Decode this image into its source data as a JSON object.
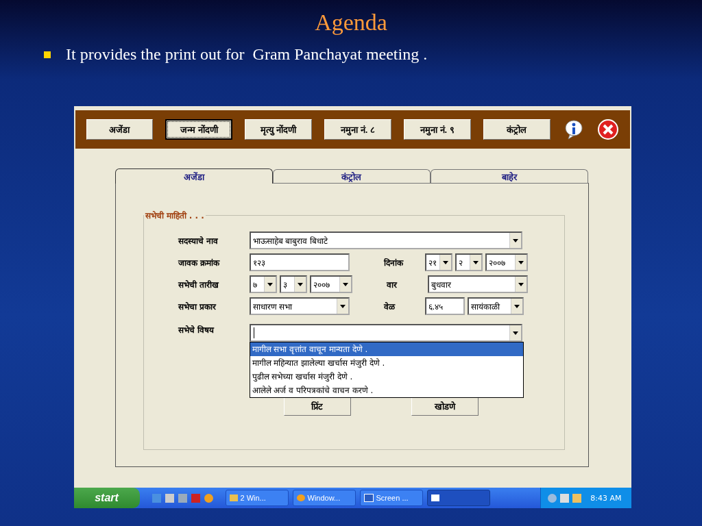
{
  "slide": {
    "title": "Agenda",
    "bullets": [
      "It provides the print out for  Gram Panchayat meeting ."
    ]
  },
  "app": {
    "toolbar": [
      {
        "label": "अजेंडा",
        "focused": false
      },
      {
        "label": "जन्म नोंदणी",
        "focused": true
      },
      {
        "label": "मृत्यु नोंदणी",
        "focused": false
      },
      {
        "label": "नमुना नं. ८",
        "focused": false
      },
      {
        "label": "नमुना नं. ९",
        "focused": false
      },
      {
        "label": "कंट्रोल",
        "focused": false
      }
    ],
    "tabs": [
      {
        "label": "अजेंडा",
        "selected": true
      },
      {
        "label": "कंट्रोल",
        "selected": false
      },
      {
        "label": "बाहेर",
        "selected": false
      }
    ],
    "group_title": "सभेची माहिती . . .",
    "member": {
      "label": "सदस्याचे नाव",
      "value": "भाऊसाहेब बाबुराव बिधाटे"
    },
    "outward_no": {
      "label": "जावक क्रमांक",
      "value": "१२३"
    },
    "date": {
      "label": "दिनांक",
      "parts": [
        "२१",
        "२",
        "२००७"
      ]
    },
    "meeting_date": {
      "label": "सभेची तारीख",
      "parts": [
        "७",
        "३",
        "२००७"
      ]
    },
    "weekday": {
      "label": "वार",
      "value": "बुधवार"
    },
    "meeting_type": {
      "label": "सभेचा प्रकार",
      "value": "साधारण सभा"
    },
    "time": {
      "label": "वेळ",
      "value": "६.४५",
      "period": "सायंकाळी"
    },
    "subject": {
      "label": "सभेचे विषय",
      "options": [
        {
          "text": "मागील सभा वृत्तांत वाचून मान्यता देणे .",
          "selected": true
        },
        {
          "text": "मागील महिन्यात झालेल्या खर्चास मंजुरी देणे .",
          "selected": false
        },
        {
          "text": "पुढील सभेच्या खर्चास मंजुरी देणे .",
          "selected": false
        },
        {
          "text": "आलेले अर्ज व परिपत्रकांचे वाचन करणे .",
          "selected": false
        }
      ]
    },
    "actions": [
      "प्रिंट",
      "खोडणे"
    ]
  },
  "taskbar": {
    "start": "start",
    "tasks": [
      {
        "label": "2 Win...",
        "kind": "group",
        "selected": false
      },
      {
        "label": "Window...",
        "kind": "player",
        "selected": false
      },
      {
        "label": "Screen ...",
        "kind": "doc",
        "selected": false
      },
      {
        "kind": "window",
        "selected": true
      }
    ],
    "clock": "8:43 AM"
  }
}
